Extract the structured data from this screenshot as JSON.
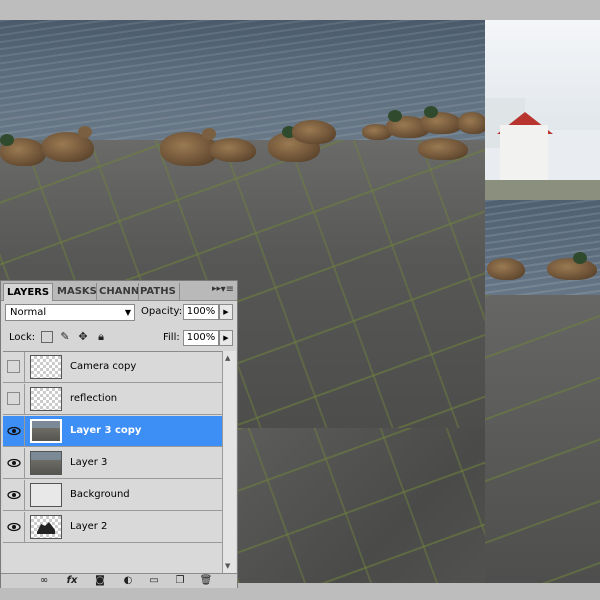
{
  "panel": {
    "tabs": [
      {
        "label": "LAYERS",
        "active": true
      },
      {
        "label": "MASKS",
        "active": false
      },
      {
        "label": "CHANN",
        "active": false
      },
      {
        "label": "PATHS",
        "active": false
      }
    ],
    "collapse_glyph": "▸▸",
    "menu_glyph": "▾≡",
    "blend_mode": "Normal",
    "opacity_label": "Opacity:",
    "opacity_value": "100%",
    "lock_label": "Lock:",
    "fill_label": "Fill:",
    "fill_value": "100%",
    "layers": [
      {
        "name": "Camera copy",
        "visible": false,
        "thumb": "checker",
        "selected": false
      },
      {
        "name": "reflection",
        "visible": false,
        "thumb": "checker",
        "selected": false
      },
      {
        "name": "Layer 3 copy",
        "visible": true,
        "thumb": "photo",
        "selected": true
      },
      {
        "name": "Layer 3",
        "visible": true,
        "thumb": "photo",
        "selected": false
      },
      {
        "name": "Background",
        "visible": true,
        "thumb": "bg",
        "selected": false
      },
      {
        "name": "Layer 2",
        "visible": true,
        "thumb": "checker",
        "selected": false
      }
    ],
    "bottom_icons": [
      "link-icon",
      "fx-icon",
      "mask-icon",
      "adjustment-icon",
      "folder-icon",
      "new-layer-icon",
      "trash-icon"
    ]
  },
  "colors": {
    "selection": "#3d8ef5",
    "panel_bg": "#d6d6d6"
  }
}
